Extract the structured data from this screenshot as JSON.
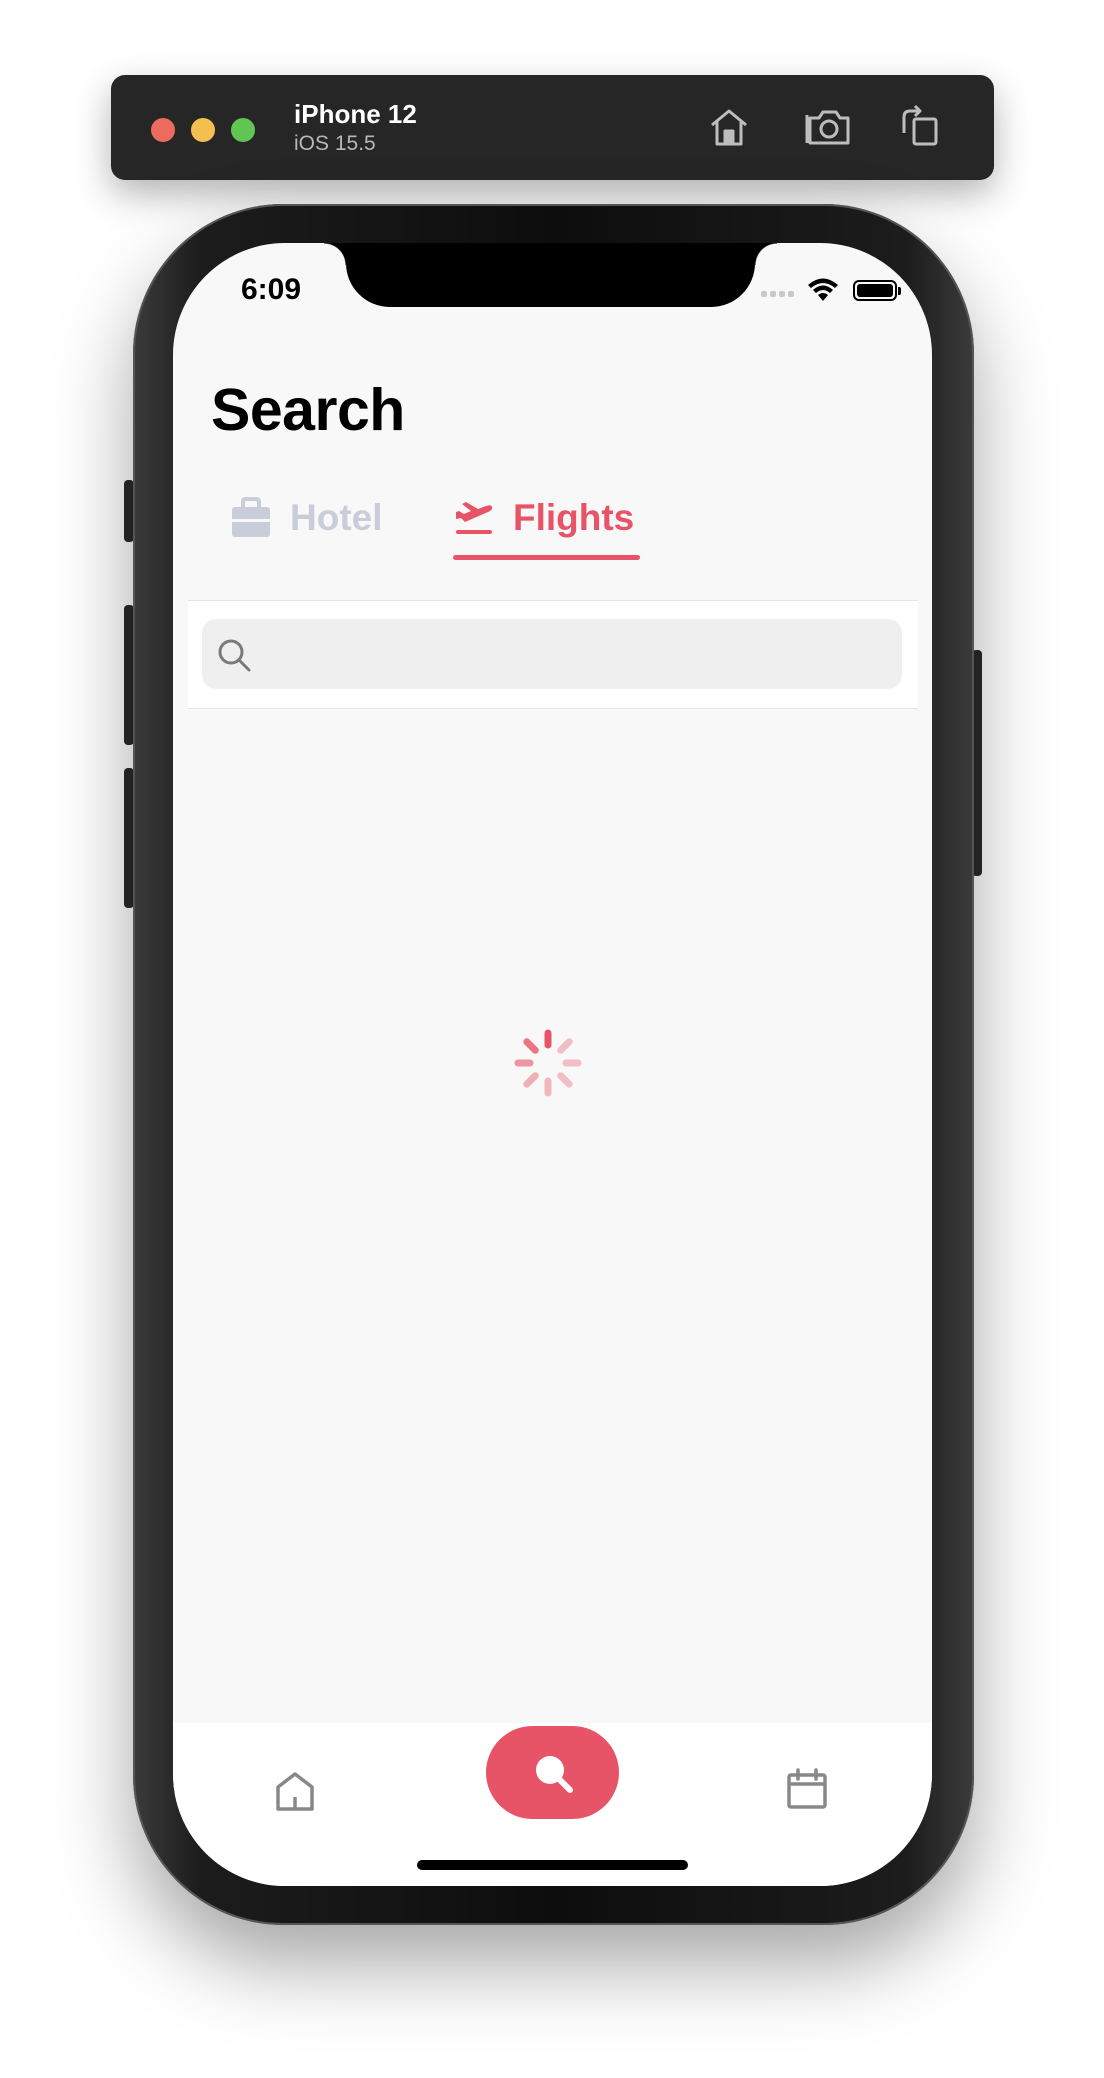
{
  "simulator": {
    "device_name": "iPhone 12",
    "os_version": "iOS 15.5",
    "buttons": {
      "home": "home-icon",
      "screenshot": "camera-icon",
      "rotate": "rotate-icon"
    }
  },
  "status_bar": {
    "time": "6:09"
  },
  "page": {
    "title": "Search"
  },
  "tabs": [
    {
      "label": "Hotel",
      "icon": "briefcase-icon",
      "active": false
    },
    {
      "label": "Flights",
      "icon": "airplane-takeoff-icon",
      "active": true
    }
  ],
  "search": {
    "value": "",
    "placeholder": ""
  },
  "loading": {
    "state": "loading",
    "icon": "spinner-icon"
  },
  "tab_bar": {
    "items": [
      {
        "name": "home",
        "icon": "home-icon",
        "active": false
      },
      {
        "name": "search",
        "icon": "search-icon",
        "active": true
      },
      {
        "name": "calendar",
        "icon": "calendar-icon",
        "active": false
      }
    ]
  },
  "colors": {
    "accent": "#e85467",
    "inactive_tab": "#c9ccd9",
    "background": "#f8f8f9",
    "toolbar": "#262626"
  }
}
